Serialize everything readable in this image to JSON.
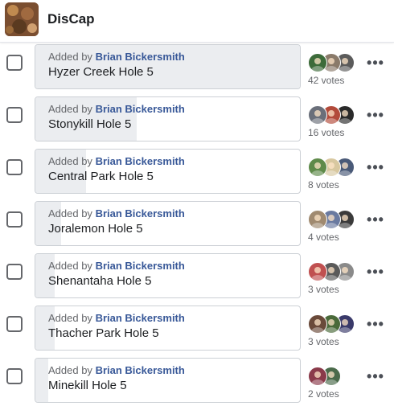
{
  "group": {
    "title": "DisCap",
    "thumbnail_icon": "group-cover-photo"
  },
  "colors": {
    "link": "#385898",
    "muted": "#65676b",
    "text": "#1c1e21",
    "fill": "#ebedf0",
    "border": "#ccd0d5"
  },
  "poll": {
    "options": [
      {
        "added_prefix": "Added by",
        "author": "Brian Bickersmith",
        "name": "Hyzer Creek Hole 5",
        "votes_label": "42 votes",
        "votes": 42,
        "voter_colors": [
          "#3d6b3a",
          "#8a7a6a",
          "#5b5b5b"
        ]
      },
      {
        "added_prefix": "Added by",
        "author": "Brian Bickersmith",
        "name": "Stonykill Hole 5",
        "votes_label": "16 votes",
        "votes": 16,
        "voter_colors": [
          "#6a6f7a",
          "#b24a3a",
          "#2a2a2a"
        ]
      },
      {
        "added_prefix": "Added by",
        "author": "Brian Bickersmith",
        "name": "Central Park Hole 5",
        "votes_label": "8 votes",
        "votes": 8,
        "voter_colors": [
          "#5f8a4a",
          "#d8c8a0",
          "#4a5a78"
        ]
      },
      {
        "added_prefix": "Added by",
        "author": "Brian Bickersmith",
        "name": "Joralemon Hole 5",
        "votes_label": "4 votes",
        "votes": 4,
        "voter_colors": [
          "#a08a70",
          "#6a7aa0",
          "#3a3a3a"
        ]
      },
      {
        "added_prefix": "Added by",
        "author": "Brian Bickersmith",
        "name": "Shenantaha Hole 5",
        "votes_label": "3 votes",
        "votes": 3,
        "voter_colors": [
          "#c05050",
          "#5a5a5a",
          "#8a8a8a"
        ]
      },
      {
        "added_prefix": "Added by",
        "author": "Brian Bickersmith",
        "name": "Thacher Park Hole 5",
        "votes_label": "3 votes",
        "votes": 3,
        "voter_colors": [
          "#6a4a3a",
          "#4a6a3a",
          "#3a3a6a"
        ]
      },
      {
        "added_prefix": "Added by",
        "author": "Brian Bickersmith",
        "name": "Minekill Hole 5",
        "votes_label": "2 votes",
        "votes": 2,
        "voter_colors": [
          "#8a3a4a",
          "#4a6a4a"
        ]
      }
    ],
    "more_label": "•••"
  }
}
